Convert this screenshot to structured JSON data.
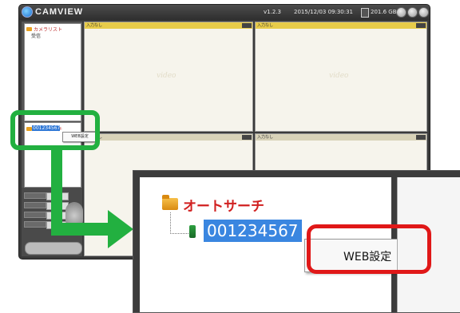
{
  "app": {
    "title": "CAMVIEW",
    "version": "v1.2.3",
    "datetime": "2015/12/03 09:30:31",
    "disk": "201.6 GB"
  },
  "camera_list": {
    "header": "カメラリスト",
    "item": "受信"
  },
  "auto_search": {
    "header": "オートサーチ",
    "device_id": "001234567"
  },
  "context_menu": {
    "item": "WEB設定"
  },
  "video": {
    "cell_label": "入力なし",
    "watermark": "video"
  },
  "colors": {
    "highlight_green": "#22b040",
    "highlight_red": "#e01818",
    "selection_blue": "#3a86e0"
  }
}
